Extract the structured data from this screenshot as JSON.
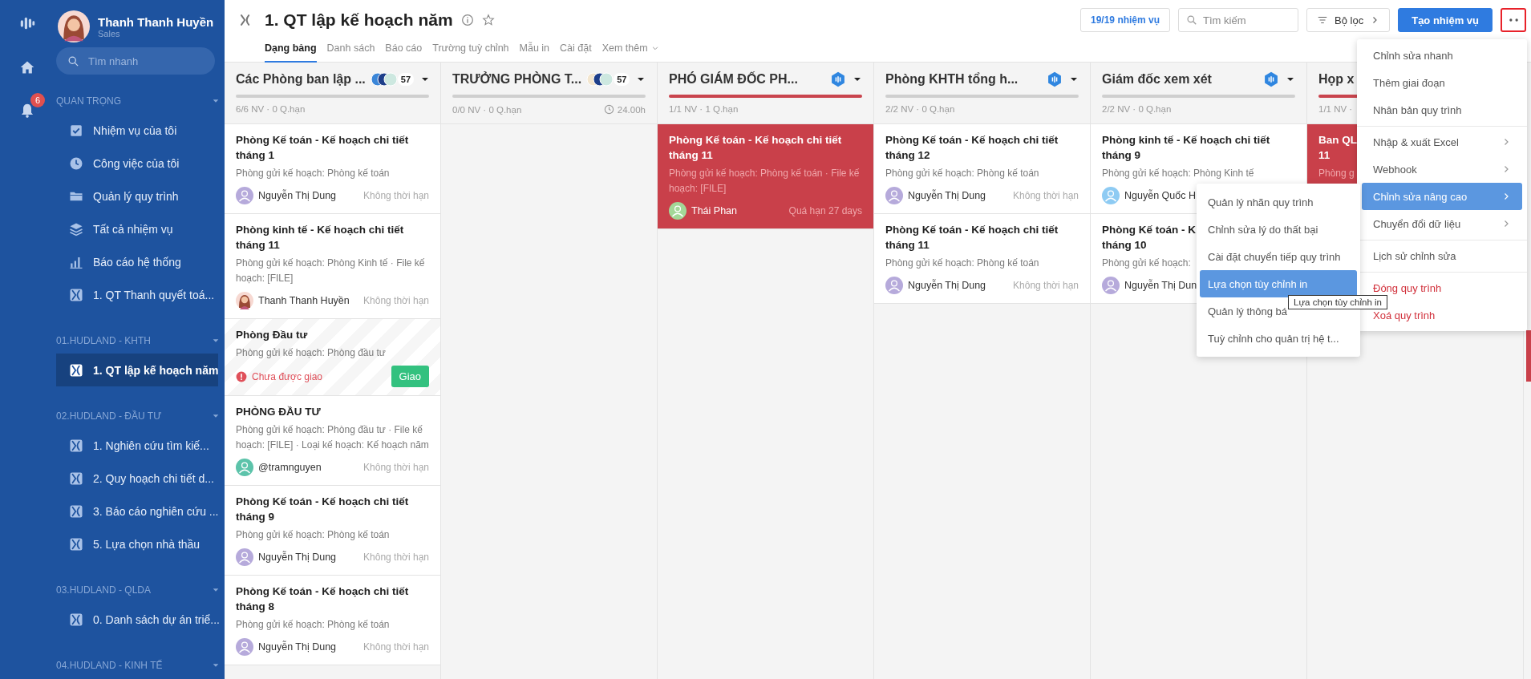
{
  "rail": {
    "notification_count": "6"
  },
  "sidebar": {
    "user": {
      "name": "Thanh Thanh Huyền",
      "role": "Sales"
    },
    "search": {
      "placeholder": "Tìm nhanh"
    },
    "groups": [
      {
        "title": "QUAN TRỌNG",
        "items": [
          {
            "label": "Nhiệm vụ của tôi",
            "kind": "check",
            "selected": false
          },
          {
            "label": "Công việc của tôi",
            "kind": "clock",
            "selected": false
          },
          {
            "label": "Quản lý quy trình",
            "kind": "folder",
            "selected": false
          },
          {
            "label": "Tất cả nhiệm vụ",
            "kind": "layers",
            "selected": false
          },
          {
            "label": "Báo cáo hệ thống",
            "kind": "chart",
            "selected": false
          },
          {
            "label": "1. QT Thanh quyết toá...",
            "kind": "process",
            "selected": false
          }
        ]
      },
      {
        "title": "01.HUDLAND - KHTH",
        "items": [
          {
            "label": "1. QT lập kế hoạch năm",
            "kind": "process",
            "selected": true
          }
        ]
      },
      {
        "title": "02.HUDLAND - ĐẦU TƯ",
        "items": [
          {
            "label": "1. Nghiên cứu tìm kiế...",
            "kind": "process",
            "selected": false
          },
          {
            "label": "2. Quy hoạch chi tiết d...",
            "kind": "process",
            "selected": false
          },
          {
            "label": "3. Báo cáo nghiên cứu ...",
            "kind": "process",
            "selected": false
          },
          {
            "label": "5. Lựa chọn nhà thầu",
            "kind": "process",
            "selected": false
          }
        ]
      },
      {
        "title": "03.HUDLAND - QLDA",
        "items": [
          {
            "label": "0. Danh sách dự án triể...",
            "kind": "process",
            "selected": false
          }
        ]
      },
      {
        "title": "04.HUDLAND - KINH TẾ"
      }
    ]
  },
  "header": {
    "title": "1. QT lập kế hoạch năm",
    "task_count": "19/19 nhiệm vụ",
    "search": {
      "placeholder": "Tìm kiếm"
    },
    "filter": "Bộ lọc",
    "create": "Tạo nhiệm vụ",
    "more_active": true
  },
  "tabs": [
    {
      "label": "Dạng bảng",
      "kind": "tab",
      "selected": true
    },
    {
      "label": "Danh sách",
      "kind": "tab",
      "selected": false
    },
    {
      "label": "Báo cáo",
      "kind": "tab",
      "selected": false
    },
    {
      "label": "Trường tuỳ chỉnh",
      "kind": "tab",
      "selected": false
    },
    {
      "label": "Mẫu in",
      "kind": "tab",
      "selected": false
    },
    {
      "label": "Cài đặt",
      "kind": "tab",
      "selected": false
    },
    {
      "label": "Xem thêm",
      "kind": "dropdown",
      "selected": false
    }
  ],
  "columns": [
    {
      "title": "Các Phòng ban lập ...",
      "kind": "members",
      "member_count": "57",
      "stats": "6/6 NV · 0 Q.hạn",
      "overdue": false,
      "cards": [
        {
          "kind": "task",
          "title": "Phòng Kế toán - Kế hoạch chi tiết tháng 1",
          "description": "Phòng gửi kế hoạch: Phòng kế toán",
          "assignee": "Nguyễn Thị Dung",
          "avatar": {
            "kind": "generic",
            "color": "#b6aadb"
          },
          "due": "Không thời hạn",
          "overdue": false
        },
        {
          "kind": "task",
          "title": "Phòng kinh tế - Kế hoạch chi tiết tháng 11",
          "description": "Phòng gửi kế hoạch: Phòng Kinh tế · File kế hoạch: [FILE]",
          "assignee": "Thanh Thanh Huyền",
          "avatar": {
            "kind": "portrait"
          },
          "due": "Không thời hạn",
          "overdue": false
        },
        {
          "kind": "unassigned",
          "title": "Phòng Đầu tư",
          "description": "Phòng gửi kế hoạch: Phòng đầu tư",
          "warning": "Chưa được giao",
          "action": "Giao",
          "overdue": false
        },
        {
          "kind": "task",
          "title": "PHÒNG ĐẦU TƯ",
          "description": "Phòng gửi kế hoạch: Phòng đầu tư · File kế hoạch: [FILE] · Loại kế hoạch: Kế hoạch năm",
          "assignee": "@tramnguyen",
          "avatar": {
            "kind": "generic",
            "color": "#5cc3aa"
          },
          "due": "Không thời hạn",
          "overdue": false
        },
        {
          "kind": "task",
          "title": "Phòng Kế toán - Kế hoạch chi tiết tháng 9",
          "description": "Phòng gửi kế hoạch: Phòng kế toán",
          "assignee": "Nguyễn Thị Dung",
          "avatar": {
            "kind": "generic",
            "color": "#b6aadb"
          },
          "due": "Không thời hạn",
          "overdue": false
        },
        {
          "kind": "task",
          "title": "Phòng Kế toán - Kế hoạch chi tiết tháng 8",
          "description": "Phòng gửi kế hoạch: Phòng kế toán",
          "assignee": "Nguyễn Thị Dung",
          "avatar": {
            "kind": "generic",
            "color": "#b6aadb"
          },
          "due": "Không thời hạn",
          "overdue": false
        }
      ]
    },
    {
      "title": "TRƯỞNG PHÒNG T...",
      "kind": "members",
      "member_count": "57",
      "stats": "0/0 NV · 0 Q.hạn",
      "duration": "24.00h",
      "overdue": false
    },
    {
      "title": "PHÓ GIÁM ĐỐC PH...",
      "kind": "bot",
      "stats": "1/1 NV · 1 Q.hạn",
      "overdue": true,
      "cards": [
        {
          "kind": "task",
          "title": "Phòng Kế toán - Kế hoạch chi tiết tháng 11",
          "description": "Phòng gửi kế hoạch: Phòng kế toán · File kế hoạch: [FILE]",
          "assignee": "Thái Phan",
          "avatar": {
            "kind": "generic",
            "color": "#a3d797"
          },
          "due": "Quá hạn 27 days",
          "overdue": true
        }
      ]
    },
    {
      "title": "Phòng KHTH tổng h...",
      "kind": "bot",
      "stats": "2/2 NV · 0 Q.hạn",
      "overdue": false,
      "cards": [
        {
          "kind": "task",
          "title": "Phòng Kế toán - Kế hoạch chi tiết tháng 12",
          "description": "Phòng gửi kế hoạch: Phòng kế toán",
          "assignee": "Nguyễn Thị Dung",
          "avatar": {
            "kind": "generic",
            "color": "#b6aadb"
          },
          "due": "Không thời hạn",
          "overdue": false
        },
        {
          "kind": "task",
          "title": "Phòng Kế toán - Kế hoạch chi tiết tháng 11",
          "description": "Phòng gửi kế hoạch: Phòng kế toán",
          "assignee": "Nguyễn Thị Dung",
          "avatar": {
            "kind": "generic",
            "color": "#b6aadb"
          },
          "due": "Không thời hạn",
          "overdue": false
        }
      ]
    },
    {
      "title": "Giám đốc xem xét",
      "kind": "bot",
      "stats": "2/2 NV · 0 Q.hạn",
      "overdue": false,
      "cards": [
        {
          "kind": "task",
          "title": "Phòng kinh tế - Kế hoạch chi tiết tháng 9",
          "description": "Phòng gửi kế hoạch: Phòng Kinh tế",
          "assignee": "Nguyễn Quốc H",
          "avatar": {
            "kind": "generic",
            "color": "#8ecbf3"
          },
          "overdue": false
        },
        {
          "kind": "task",
          "title": "Phòng Kế toán - K\ntháng 10",
          "description": "Phòng gửi kế hoạch:",
          "assignee": "Nguyễn Thị Dun",
          "avatar": {
            "kind": "generic",
            "color": "#b6aadb"
          },
          "overdue": false
        }
      ]
    },
    {
      "title": "Họp x",
      "kind": "plain",
      "stats": "1/1 NV ·",
      "overdue": true,
      "cards": [
        {
          "kind": "task",
          "title": "Ban QL\n11",
          "description": "Phòng g",
          "overdue": true
        }
      ]
    }
  ],
  "menu": {
    "sections": [
      {
        "items": [
          {
            "label": "Chỉnh sửa nhanh",
            "has_submenu": false,
            "selected": false,
            "danger": false
          },
          {
            "label": "Thêm giai đoạn",
            "has_submenu": false,
            "selected": false,
            "danger": false
          },
          {
            "label": "Nhân bản quy trình",
            "has_submenu": false,
            "selected": false,
            "danger": false
          }
        ]
      },
      {
        "items": [
          {
            "label": "Nhập & xuất Excel",
            "has_submenu": true,
            "selected": false,
            "danger": false
          },
          {
            "label": "Webhook",
            "has_submenu": true,
            "selected": false,
            "danger": false
          },
          {
            "label": "Chỉnh sửa nâng cao",
            "has_submenu": true,
            "selected": true,
            "danger": false
          },
          {
            "label": "Chuyển đổi dữ liệu",
            "has_submenu": true,
            "selected": false,
            "danger": false
          }
        ]
      },
      {
        "items": [
          {
            "label": "Lịch sử chỉnh sửa",
            "has_submenu": false,
            "selected": false,
            "danger": false
          }
        ]
      },
      {
        "items": [
          {
            "label": "Đóng quy trình",
            "has_submenu": false,
            "selected": false,
            "danger": true
          },
          {
            "label": "Xoá quy trình",
            "has_submenu": false,
            "selected": false,
            "danger": true
          }
        ]
      }
    ]
  },
  "submenu": {
    "items": [
      {
        "label": "Quản lý nhãn quy trình",
        "selected": false
      },
      {
        "label": "Chỉnh sửa lý do thất bại",
        "selected": false
      },
      {
        "label": "Cài đặt chuyển tiếp quy trình",
        "selected": false
      },
      {
        "label": "Lựa chọn tùy chỉnh in",
        "selected": true
      },
      {
        "label": "Quản lý thông bá",
        "selected": false
      },
      {
        "label": "Tuỳ chỉnh cho quản trị hệ t...",
        "selected": false
      }
    ]
  },
  "tooltip": {
    "text": "Lựa chọn tùy chỉnh in"
  }
}
